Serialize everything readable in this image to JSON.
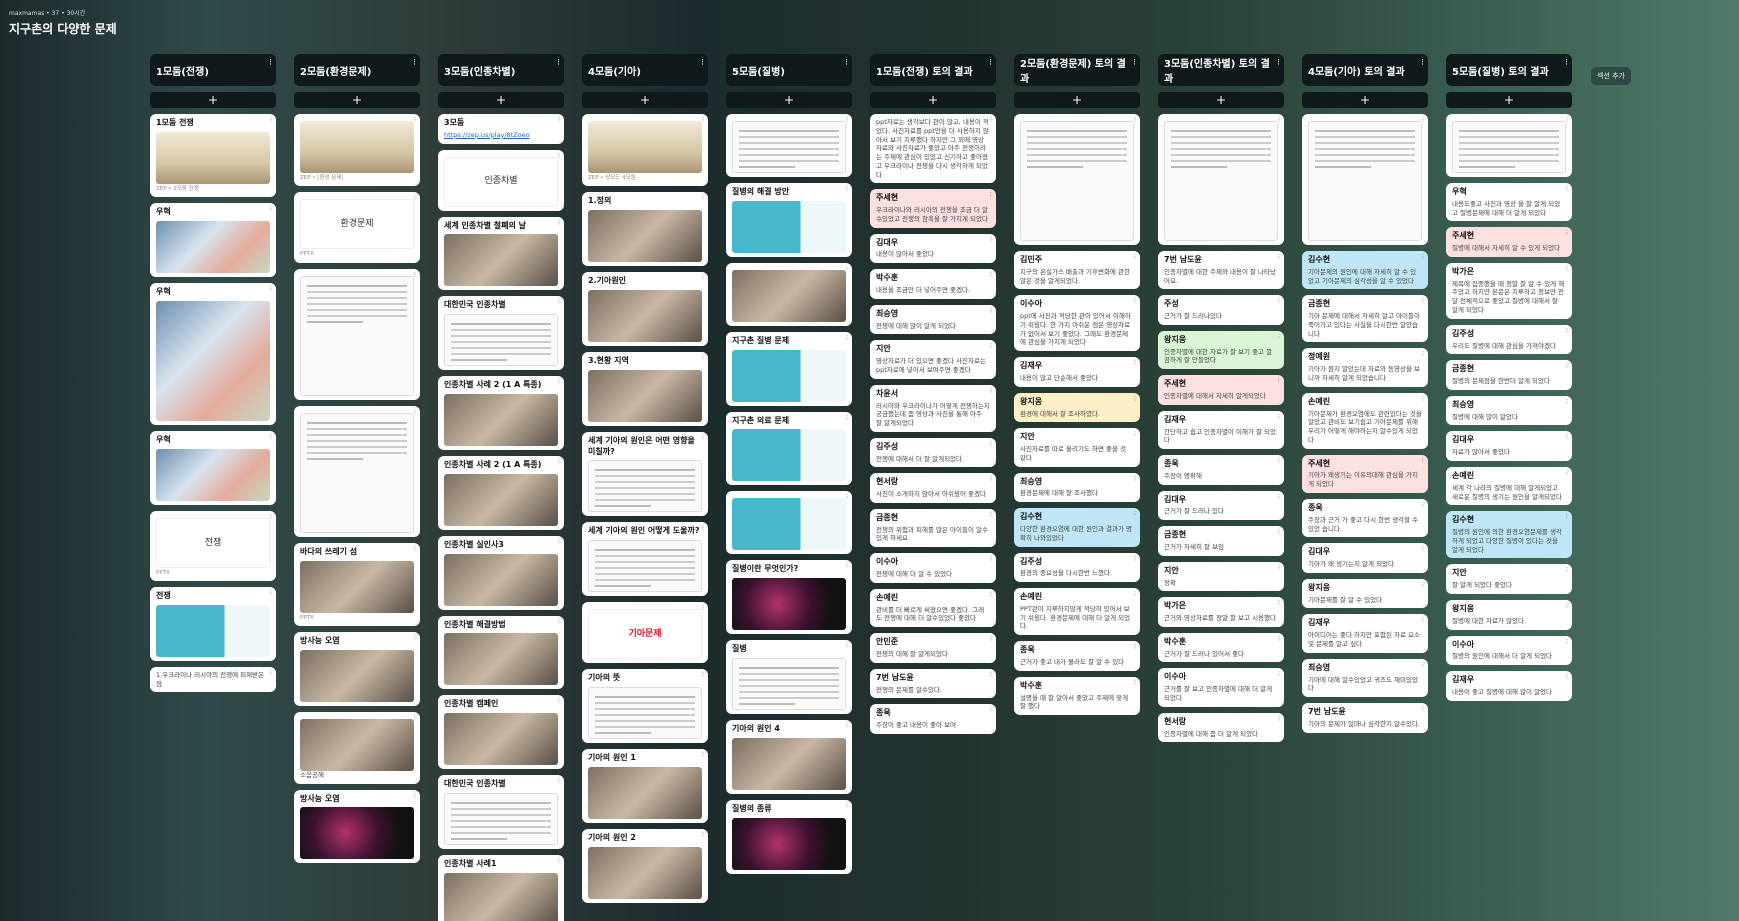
{
  "meta": "maxmamas • 37 • 30시간",
  "board_title": "지구촌의 다양한 문제",
  "add_label": "+",
  "more_label": "⁝",
  "section_add": "섹션 추가",
  "columns": [
    {
      "title": "1모둠(전쟁)",
      "posts": [
        {
          "title": "1모둠 전쟁",
          "thumb": "scene",
          "caption": "ZEP • 1모둠 전쟁"
        },
        {
          "title": "우혁",
          "thumb": "map"
        },
        {
          "title": "우혁",
          "thumb": "map",
          "tall": true
        },
        {
          "title": "우혁",
          "thumb": "map"
        },
        {
          "title": "",
          "slide": "전쟁",
          "caption": "PPTX"
        },
        {
          "title": "전쟁",
          "thumb": "teal"
        },
        {
          "title": "",
          "body": "1.우크라이나 러시아의 전쟁에 피해받은 점"
        }
      ]
    },
    {
      "title": "2모둠(환경문제)",
      "posts": [
        {
          "title": "",
          "thumb": "scene",
          "caption": "ZEP • [환경 문제]"
        },
        {
          "title": "",
          "slide": "환경문제",
          "caption": "PPTX"
        },
        {
          "title": "",
          "thumb": "doc",
          "tall": true
        },
        {
          "title": "",
          "thumb": "doc",
          "tall": true
        },
        {
          "title": "바다의 쓰레기 섬",
          "thumb": "photo",
          "caption": "PPTX"
        },
        {
          "title": "방사능 오염",
          "thumb": "photo"
        },
        {
          "title": "",
          "body": "소음공해",
          "thumb": "photo"
        },
        {
          "title": "방사능 오염",
          "thumb": "dark"
        }
      ]
    },
    {
      "title": "3모둠(인종차별)",
      "posts": [
        {
          "title": "3모둠",
          "link": "https://zep.us/play/8tZoeo"
        },
        {
          "title": "",
          "slide": "인종차별"
        },
        {
          "title": "세계 인종차별 철폐의 날",
          "thumb": "photo"
        },
        {
          "title": "대한민국 인종차별",
          "thumb": "doc"
        },
        {
          "title": "인종차별 사례 2 (1 A 특종)",
          "thumb": "photo"
        },
        {
          "title": "인종차별 사례 2 (1 A 특종)",
          "thumb": "photo"
        },
        {
          "title": "인종차별 실인사3",
          "thumb": "photo"
        },
        {
          "title": "인종차별 해결방법",
          "thumb": "photo"
        },
        {
          "title": "인종차별 캠페인",
          "thumb": "photo"
        },
        {
          "title": "대한민국 인종차별",
          "thumb": "doc"
        },
        {
          "title": "인종차별 사례1",
          "thumb": "photo"
        }
      ]
    },
    {
      "title": "4모둠(기아)",
      "posts": [
        {
          "title": "",
          "thumb": "scene",
          "caption": "ZEP • 상모드 4모둠"
        },
        {
          "title": "1.정의",
          "thumb": "photo"
        },
        {
          "title": "2.기아원인",
          "thumb": "photo"
        },
        {
          "title": "3.현황 지역",
          "thumb": "photo"
        },
        {
          "title": "세계 기아의 원인은 어떤 영향을 미칠까?",
          "thumb": "doc"
        },
        {
          "title": "세계 기아의 원인 어떻게 도울까?",
          "thumb": "doc"
        },
        {
          "title": "",
          "slide": "기아문제",
          "slideRed": true
        },
        {
          "title": "기아의 뜻",
          "thumb": "doc"
        },
        {
          "title": "기아의 원인 1",
          "thumb": "photo"
        },
        {
          "title": "기아의 원인 2",
          "thumb": "photo"
        }
      ]
    },
    {
      "title": "5모둠(질병)",
      "posts": [
        {
          "title": "",
          "thumb": "doc"
        },
        {
          "title": "질병의 해결 방안",
          "thumb": "teal"
        },
        {
          "title": "",
          "thumb": "photo"
        },
        {
          "title": "지구촌 질병 문제",
          "thumb": "teal"
        },
        {
          "title": "지구촌 의료 문제",
          "thumb": "teal"
        },
        {
          "title": "",
          "thumb": "teal"
        },
        {
          "title": "질병이란 무엇인가?",
          "thumb": "dark"
        },
        {
          "title": "질병",
          "thumb": "doc"
        },
        {
          "title": "기아의 원인 4",
          "thumb": "photo"
        },
        {
          "title": "질병의 종류",
          "thumb": "dark"
        }
      ]
    },
    {
      "title": "1모둠(전쟁) 토의 결과",
      "posts": [
        {
          "title": "",
          "body": "ppt자료는 생각보다 관이 많고, 내용이 적었다. 사진자료를 ppt만을 더 사용하지 않아서 보기 지루했다 하지만 그 외에 영상자료와 사진자료가 좋았고 아주 전쟁이라는 주제에 관심이 있었고 신기하고 좋아졌고 우크라이나 전쟁을 다시 생각하게 되었다"
        },
        {
          "title": "주세현",
          "color": "pink",
          "body": "우크라이나와 러시아의 전쟁을 조금 더 알수있었고 전쟁의 참혹을 잘 가지게 되었다"
        },
        {
          "title": "김대우",
          "body": "내용이 많아서 좋았다"
        },
        {
          "title": "박수훈",
          "body": "내용을 조금만 더 넣어주면 좋겠다."
        },
        {
          "title": "최승영",
          "body": "전쟁에 대해 많이 알게 되었다"
        },
        {
          "title": "지안",
          "body": "영상자료가 더 있으면 좋겠다 사진자료는 ppt자료에 넣어서 보여주면 좋겠다"
        },
        {
          "title": "차윤서",
          "body": "러시아와 우크라이나가 어떻게 전쟁하는지 궁금했는데 좀 영상과 사진을 통해 아주 잘 알게되었다"
        },
        {
          "title": "김주성",
          "body": "전쟁에 대해서 더 잘 알게되었다."
        },
        {
          "title": "현서랑",
          "body": "사진이 소개하지 않아서 아쉬웠어 좋겠다"
        },
        {
          "title": "금종현",
          "body": "전쟁의 위험과 피해를 많은 아이들이 알수있게 하세요"
        },
        {
          "title": "이수아",
          "body": "전쟁에 대해 더 알 수 있었다"
        },
        {
          "title": "손예린",
          "body": "관비를 더 빠르게 써졌으면 좋겠다. 그래도 전쟁에 대해 더 알수있었다 좋았다"
        },
        {
          "title": "안민준",
          "body": "전쟁의 대해 잘 알게되었다"
        },
        {
          "title": "7번 남도윤",
          "body": "전쟁의 문제를 알수있다."
        },
        {
          "title": "종욱",
          "body": "주장이 좋고 내용이 좋아 보여"
        }
      ]
    },
    {
      "title": "2모둠(환경문제) 토의 결과",
      "posts": [
        {
          "title": "",
          "thumb": "doc",
          "tall": true
        },
        {
          "title": "김민주",
          "body": "지구의 온실가스 배출과 기후변화에 관한 많은 것을 알게되었다."
        },
        {
          "title": "이수아",
          "body": "ppt에 사진과 적당한 관이 있어서 이해하기 쉬웠다. 한 가지 아쉬운 점은 영상자료가 없어서 보기 좋았다. 그래도 환경문제에 관심을 가지게 되었다"
        },
        {
          "title": "김재우",
          "body": "내용이 많고 단순해서 좋았다"
        },
        {
          "title": "왕지웅",
          "color": "yellow",
          "body": "환경에 대해서 잘 조사하였다."
        },
        {
          "title": "지안",
          "body": "사진자료를 따로 올리기도 하면 좋을 것 같다"
        },
        {
          "title": "최승영",
          "body": "환경문제에 대해 잘 조사했다"
        },
        {
          "title": "김수현",
          "color": "blue",
          "body": "다양한 환경오염에 대한 원인과 결과가 명확히 나와있었다"
        },
        {
          "title": "김주성",
          "body": "환경의 중요성을 다시한번 느꼈다."
        },
        {
          "title": "손예린",
          "body": "PPT관이 지루하지않게 적당히 있어서 보기 쉬웠다. 환경문제에 대해 더 알게 되었다."
        },
        {
          "title": "종욱",
          "body": "근거가 좋고 내가 몰라도 잘 알 수 있다"
        },
        {
          "title": "박수훈",
          "body": "설명을 때 잘 알아서 좋았고 주제에 맞게 잘 했다"
        }
      ]
    },
    {
      "title": "3모둠(인종차별) 토의 결과",
      "posts": [
        {
          "title": "",
          "thumb": "doc",
          "tall": true
        },
        {
          "title": "7번 남도윤",
          "body": "인종차별에 대한 주제와 내용이 잘 나타났어요."
        },
        {
          "title": "주성",
          "body": "근거가 잘 드러나있다"
        },
        {
          "title": "왕지웅",
          "color": "green",
          "body": "인종차별에 대한 자료가 잘 보기 좋고 깔끔하게 잘 만들었다"
        },
        {
          "title": "주세현",
          "color": "pink",
          "body": "인종차별에 대해서 자세히 알게되었다"
        },
        {
          "title": "김재우",
          "body": "간단하고 쉽고 인종차별이 이해가 잘 되었다"
        },
        {
          "title": "종욱",
          "body": "주장이 명확해"
        },
        {
          "title": "김대우",
          "body": "근거가 잘 드러나 있다"
        },
        {
          "title": "금종현",
          "body": "근거가 자세히 잘 보임"
        },
        {
          "title": "지안",
          "body": "정확"
        },
        {
          "title": "박가은",
          "body": "근거와 영상자료를 정말 잘 보고 시용했다"
        },
        {
          "title": "박수훈",
          "body": "근거가 잘 드러나 있어서 좋다"
        },
        {
          "title": "이수아",
          "body": "근거를 잘 보고 인종차별에 대해 더 알게 되었다"
        },
        {
          "title": "현서랑",
          "body": "인종차별에 대해 좀 더 알게 되었다"
        }
      ]
    },
    {
      "title": "4모둠(기아) 토의 결과",
      "posts": [
        {
          "title": "",
          "thumb": "doc",
          "tall": true
        },
        {
          "title": "김수현",
          "color": "blue",
          "body": "기아문제의 원인에 대해 자세히 알 수 있었고 기아문제의 심각성을 알 수 있었다"
        },
        {
          "title": "금종현",
          "body": "기아 문제에 대해서 자세히 알고 아이들이 죽어가고 있다는 사실을 다시한번 알았습니다"
        },
        {
          "title": "정예원",
          "body": "기아가 뭔지 알았는데 자료와 동영상을 보니까 자세히 알게 되었습니다"
        },
        {
          "title": "손예린",
          "body": "기아문제가 환경오염에도 관련있다는 것을 알았고 관비도 보기쉽고 기아문제를 위해 우리가 어떻게 해야하는지 알수있게 되었다"
        },
        {
          "title": "주세현",
          "color": "pink",
          "body": "기아가 왜생기는 이유의대해 관심을 가지게 되었다"
        },
        {
          "title": "종욱",
          "body": "주장과 근거 가 좋고 다시 한번 생각할 수 있었 습니다."
        },
        {
          "title": "김대우",
          "body": "기아가 왜 생기는지 알게 되었다"
        },
        {
          "title": "왕지웅",
          "body": "기아문제를 잘 알 수 있었다"
        },
        {
          "title": "김재우",
          "body": "아이디어는 좋다 하지만 포함된 자료 요소 및 문제를 알고 싶다"
        },
        {
          "title": "최승영",
          "body": "기아에 대해 알수있었고 귀즈도 재미있었다"
        },
        {
          "title": "7번 남도윤",
          "body": "기아의 문제가 얼마나 심각한지 알수있다."
        }
      ]
    },
    {
      "title": "5모둠(질병) 토의 결과",
      "posts": [
        {
          "title": "",
          "thumb": "doc"
        },
        {
          "title": "우혁",
          "body": "내용도좋고 사진과 영상 을 잘 알게 되었고 질병문제에 대해 더 알게 되었다"
        },
        {
          "title": "주세현",
          "color": "pink",
          "body": "질병에 대해서 자세히 알 수 있게 되었다"
        },
        {
          "title": "박가은",
          "body": "제목에 집중했을 때 정말 잘 알 수 있게 해 주었고 하지만 본문은 지루하고 정보만 전달 전체적으로 좋았고 질병에 대해서 잘 알게 되었다"
        },
        {
          "title": "김주성",
          "body": "우리도 질병에 대해 관심을 가져야겠다"
        },
        {
          "title": "금종현",
          "body": "질병의 문제점을 한번더 알게 되었다"
        },
        {
          "title": "최승영",
          "body": "질병에 대해 많이 알았다"
        },
        {
          "title": "김대우",
          "body": "자료가 많아서 좋았다"
        },
        {
          "title": "손예린",
          "body": "세계 각 나라의 질병에 대해 알게되었고 새로운 질병의 생기는 원인을 알게되었다"
        },
        {
          "title": "김수현",
          "color": "blue",
          "body": "질병의 원인에 의한 환경오염문제를 생각하게 되었고 다양한 질병이 있다는 것을 알게 되었다"
        },
        {
          "title": "지안",
          "body": "잘 알게 되었다 좋았다"
        },
        {
          "title": "왕지웅",
          "body": "질병에 대한 자료가 많았다."
        },
        {
          "title": "이수아",
          "body": "질병의 원인에 대해서 더 알게 되었다"
        },
        {
          "title": "김재우",
          "body": "내용이 좋고 질병에 대해 많이 알았다"
        }
      ]
    }
  ]
}
